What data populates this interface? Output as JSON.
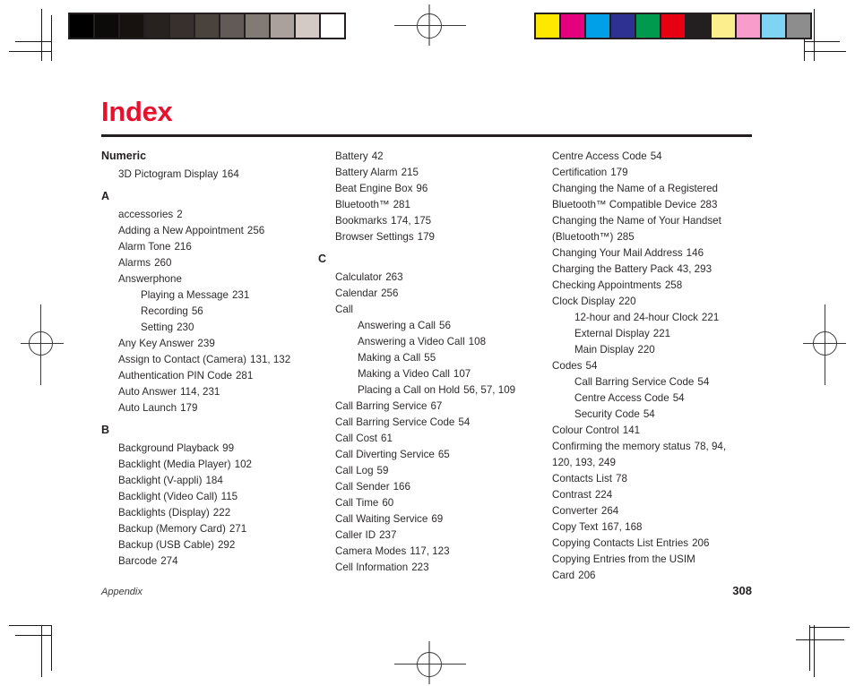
{
  "page": {
    "title": "Index",
    "accent_color": "#e8112d",
    "text_color": "#231f20"
  },
  "footer": {
    "section": "Appendix",
    "page_number": "308"
  },
  "print_marks": {
    "grayscale_wedge": [
      "#000000",
      "#0d0a0a",
      "#17120f",
      "#272120",
      "#37302c",
      "#4a423d",
      "#625a56",
      "#827a75",
      "#aaa09c",
      "#d3cac6",
      "#ffffff"
    ],
    "color_bar": [
      "#ffe800",
      "#e5007e",
      "#00a0e9",
      "#2e3192",
      "#009a4e",
      "#e60012",
      "#231f20",
      "#fcee8c",
      "#f89ccb",
      "#7fd4f4",
      "#8d8d8d"
    ]
  },
  "columns": [
    {
      "sections": [
        {
          "letter": "Numeric",
          "entries": [
            {
              "text": "3D Pictogram Display",
              "pages": "164",
              "level": 0
            }
          ]
        },
        {
          "letter": "A",
          "entries": [
            {
              "text": "accessories",
              "pages": "2",
              "level": 0
            },
            {
              "text": "Adding a New Appointment",
              "pages": "256",
              "level": 0
            },
            {
              "text": "Alarm Tone",
              "pages": "216",
              "level": 0
            },
            {
              "text": "Alarms",
              "pages": "260",
              "level": 0
            },
            {
              "text": "Answerphone",
              "pages": "",
              "level": 0
            },
            {
              "text": "Playing a Message",
              "pages": "231",
              "level": 1
            },
            {
              "text": "Recording",
              "pages": "56",
              "level": 1
            },
            {
              "text": "Setting",
              "pages": "230",
              "level": 1
            },
            {
              "text": "Any Key Answer",
              "pages": "239",
              "level": 0
            },
            {
              "text": "Assign to Contact (Camera)",
              "pages": "131, 132",
              "level": 0
            },
            {
              "text": "Authentication PIN Code",
              "pages": "281",
              "level": 0
            },
            {
              "text": "Auto Answer",
              "pages": "114, 231",
              "level": 0
            },
            {
              "text": "Auto Launch",
              "pages": "179",
              "level": 0
            }
          ]
        },
        {
          "letter": "B",
          "entries": [
            {
              "text": "Background Playback",
              "pages": "99",
              "level": 0
            },
            {
              "text": "Backlight (Media Player)",
              "pages": "102",
              "level": 0
            },
            {
              "text": "Backlight (V-appli)",
              "pages": "184",
              "level": 0
            },
            {
              "text": "Backlight (Video Call)",
              "pages": "115",
              "level": 0
            },
            {
              "text": "Backlights (Display)",
              "pages": "222",
              "level": 0
            },
            {
              "text": "Backup (Memory Card)",
              "pages": "271",
              "level": 0
            },
            {
              "text": "Backup (USB Cable)",
              "pages": "292",
              "level": 0
            },
            {
              "text": "Barcode",
              "pages": "274",
              "level": 0
            }
          ]
        }
      ]
    },
    {
      "sections": [
        {
          "letter": "",
          "entries": [
            {
              "text": "Battery",
              "pages": "42",
              "level": 0
            },
            {
              "text": "Battery Alarm",
              "pages": "215",
              "level": 0
            },
            {
              "text": "Beat Engine Box",
              "pages": "96",
              "level": 0
            },
            {
              "text": "Bluetooth™",
              "pages": "281",
              "level": 0
            },
            {
              "text": "Bookmarks",
              "pages": "174, 175",
              "level": 0
            },
            {
              "text": "Browser Settings",
              "pages": "179",
              "level": 0
            }
          ]
        },
        {
          "letter": "C",
          "entries": [
            {
              "text": "Calculator",
              "pages": "263",
              "level": 0
            },
            {
              "text": "Calendar",
              "pages": "256",
              "level": 0
            },
            {
              "text": "Call",
              "pages": "",
              "level": 0
            },
            {
              "text": "Answering a Call",
              "pages": "56",
              "level": 1
            },
            {
              "text": "Answering a Video Call",
              "pages": "108",
              "level": 1
            },
            {
              "text": "Making a Call",
              "pages": "55",
              "level": 1
            },
            {
              "text": "Making a Video Call",
              "pages": "107",
              "level": 1
            },
            {
              "text": "Placing a Call on Hold",
              "pages": "56, 57, 109",
              "level": 1
            },
            {
              "text": "Call Barring Service",
              "pages": "67",
              "level": 0
            },
            {
              "text": "Call Barring Service Code",
              "pages": "54",
              "level": 0
            },
            {
              "text": "Call Cost",
              "pages": "61",
              "level": 0
            },
            {
              "text": "Call Diverting Service",
              "pages": "65",
              "level": 0
            },
            {
              "text": "Call Log",
              "pages": "59",
              "level": 0
            },
            {
              "text": "Call Sender",
              "pages": "166",
              "level": 0
            },
            {
              "text": "Call Time",
              "pages": "60",
              "level": 0
            },
            {
              "text": "Call Waiting Service",
              "pages": "69",
              "level": 0
            },
            {
              "text": "Caller ID",
              "pages": "237",
              "level": 0
            },
            {
              "text": "Camera Modes",
              "pages": "117, 123",
              "level": 0
            },
            {
              "text": "Cell Information",
              "pages": "223",
              "level": 0
            }
          ]
        }
      ]
    },
    {
      "sections": [
        {
          "letter": "",
          "entries": [
            {
              "text": "Centre Access Code",
              "pages": "54",
              "level": 0
            },
            {
              "text": "Certification",
              "pages": "179",
              "level": 0
            },
            {
              "text": "Changing the Name of a Registered Bluetooth™ Compatible Device",
              "pages": "283",
              "level": 0
            },
            {
              "text": "Changing the Name of Your Handset (Bluetooth™)",
              "pages": "285",
              "level": 0
            },
            {
              "text": "Changing Your Mail Address",
              "pages": "146",
              "level": 0
            },
            {
              "text": "Charging the Battery Pack",
              "pages": "43, 293",
              "level": 0
            },
            {
              "text": "Checking Appointments",
              "pages": "258",
              "level": 0
            },
            {
              "text": "Clock Display",
              "pages": "220",
              "level": 0
            },
            {
              "text": "12-hour and 24-hour Clock",
              "pages": "221",
              "level": 1
            },
            {
              "text": "External Display",
              "pages": "221",
              "level": 1
            },
            {
              "text": "Main Display",
              "pages": "220",
              "level": 1
            },
            {
              "text": "Codes",
              "pages": "54",
              "level": 0
            },
            {
              "text": "Call Barring Service Code",
              "pages": "54",
              "level": 1
            },
            {
              "text": "Centre Access Code",
              "pages": "54",
              "level": 1
            },
            {
              "text": "Security Code",
              "pages": "54",
              "level": 1
            },
            {
              "text": "Colour Control",
              "pages": "141",
              "level": 0
            },
            {
              "text": "Confirming the memory status",
              "pages": "78, 94, 120, 193, 249",
              "level": 0
            },
            {
              "text": "Contacts List",
              "pages": "78",
              "level": 0
            },
            {
              "text": "Contrast",
              "pages": "224",
              "level": 0
            },
            {
              "text": "Converter",
              "pages": "264",
              "level": 0
            },
            {
              "text": "Copy Text",
              "pages": "167, 168",
              "level": 0
            },
            {
              "text": "Copying Contacts List Entries",
              "pages": "206",
              "level": 0
            },
            {
              "text": "Copying Entries from the USIM Card",
              "pages": "206",
              "level": 0
            }
          ]
        }
      ]
    }
  ]
}
